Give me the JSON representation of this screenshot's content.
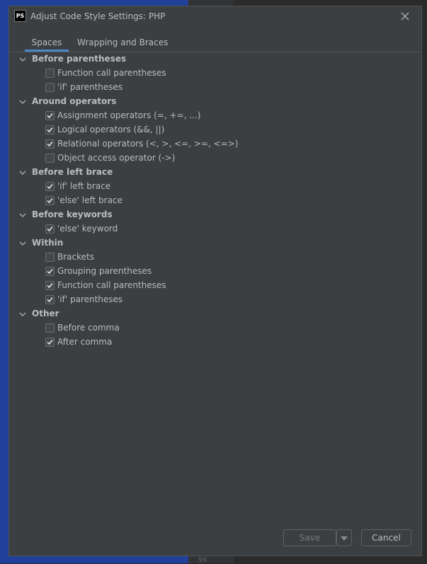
{
  "window": {
    "title": "Adjust Code Style Settings: PHP",
    "logo_text": "PS"
  },
  "tabs": [
    {
      "label": "Spaces",
      "active": true
    },
    {
      "label": "Wrapping and Braces",
      "active": false
    }
  ],
  "sections": [
    {
      "label": "Before parentheses",
      "options": [
        {
          "label": "Function call parentheses",
          "checked": false
        },
        {
          "label": "'if' parentheses",
          "checked": false
        }
      ]
    },
    {
      "label": "Around operators",
      "options": [
        {
          "label": "Assignment operators (=, +=, ...)",
          "checked": true
        },
        {
          "label": "Logical operators (&&, ||)",
          "checked": true
        },
        {
          "label": "Relational operators (<, >, <=, >=, <=>)",
          "checked": true
        },
        {
          "label": "Object access operator (->)",
          "checked": false
        }
      ]
    },
    {
      "label": "Before left brace",
      "options": [
        {
          "label": "'if' left brace",
          "checked": true
        },
        {
          "label": "'else' left brace",
          "checked": true
        }
      ]
    },
    {
      "label": "Before keywords",
      "options": [
        {
          "label": "'else' keyword",
          "checked": true
        }
      ]
    },
    {
      "label": "Within",
      "options": [
        {
          "label": "Brackets",
          "checked": false
        },
        {
          "label": "Grouping parentheses",
          "checked": true
        },
        {
          "label": "Function call parentheses",
          "checked": true
        },
        {
          "label": "'if' parentheses",
          "checked": true
        }
      ]
    },
    {
      "label": "Other",
      "options": [
        {
          "label": "Before comma",
          "checked": false
        },
        {
          "label": "After comma",
          "checked": true
        }
      ]
    }
  ],
  "footer": {
    "save_label": "Save",
    "save_enabled": false,
    "cancel_label": "Cancel"
  },
  "background": {
    "gutter_line_number": "94"
  },
  "colors": {
    "dialog_bg": "#3c3f41",
    "accent": "#4a88c7",
    "ide_blue": "#21409a"
  }
}
